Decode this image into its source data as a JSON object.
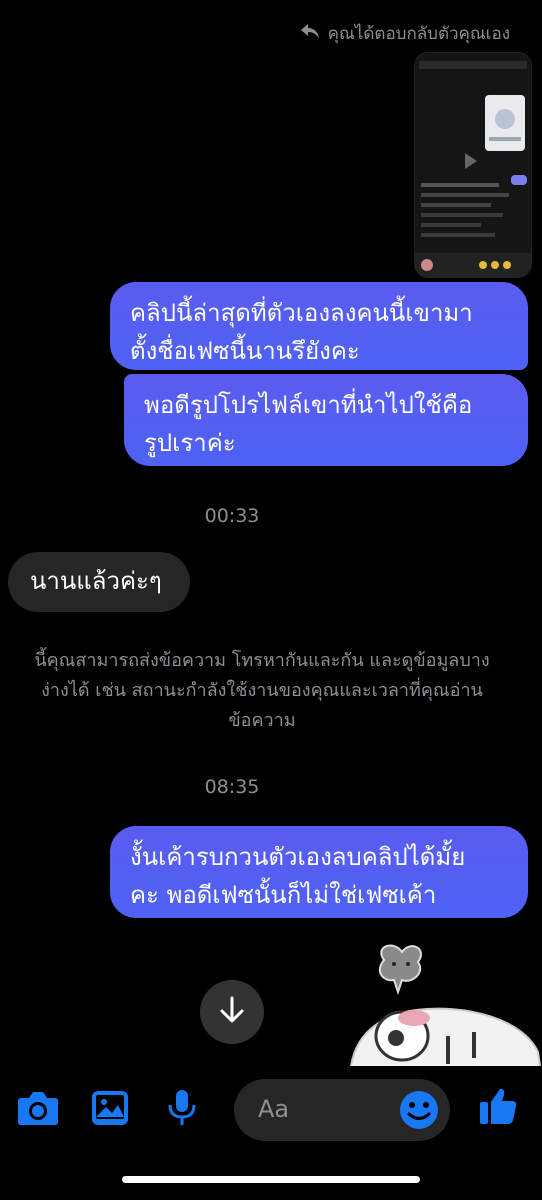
{
  "header": {
    "reply_text": "คุณได้ตอบกลับตัวคุณเอง"
  },
  "messages": [
    {
      "id": "m1",
      "text_line1": "คลิปนี้ล่าสุดที่ตัวเองลงคนนี้เขามา",
      "text_line2": "ตั้งชื่อเฟซนี้นานรึยังคะ"
    },
    {
      "id": "m2",
      "text_line1": "พอดีรูปโปรไฟล์เขาที่นำไปใช้คือ",
      "text_line2": "รูปเราค่ะ"
    },
    {
      "id": "m3",
      "text": "นานแล้วค่ะๆ"
    },
    {
      "id": "m4",
      "text_line1": "งั้นเค้ารบกวนตัวเองลบคลิปได้มั้ย",
      "text_line2": "คะ พอดีเฟซนั้นก็ไม่ใช่เฟซเค้า"
    }
  ],
  "timestamps": {
    "t1": "00:33",
    "t2": "08:35"
  },
  "notice": {
    "line1": "นี้คุณสามารถส่งข้อความ โทรหากันและกัน และดูข้อมูลบาง",
    "line2": "ง่างได้ เช่น สถานะกำลังใช้งานของคุณและเวลาที่คุณอ่าน",
    "line3": "ข้อความ"
  },
  "composer": {
    "placeholder": "Aa"
  },
  "colors": {
    "accent": "#1877f2",
    "bubble_out": "#5b5cf0",
    "bubble_in": "#262626"
  },
  "icons": [
    "reply-icon",
    "arrow-down-icon",
    "camera-icon",
    "image-icon",
    "microphone-icon",
    "emoji-icon",
    "thumbs-up-icon"
  ]
}
